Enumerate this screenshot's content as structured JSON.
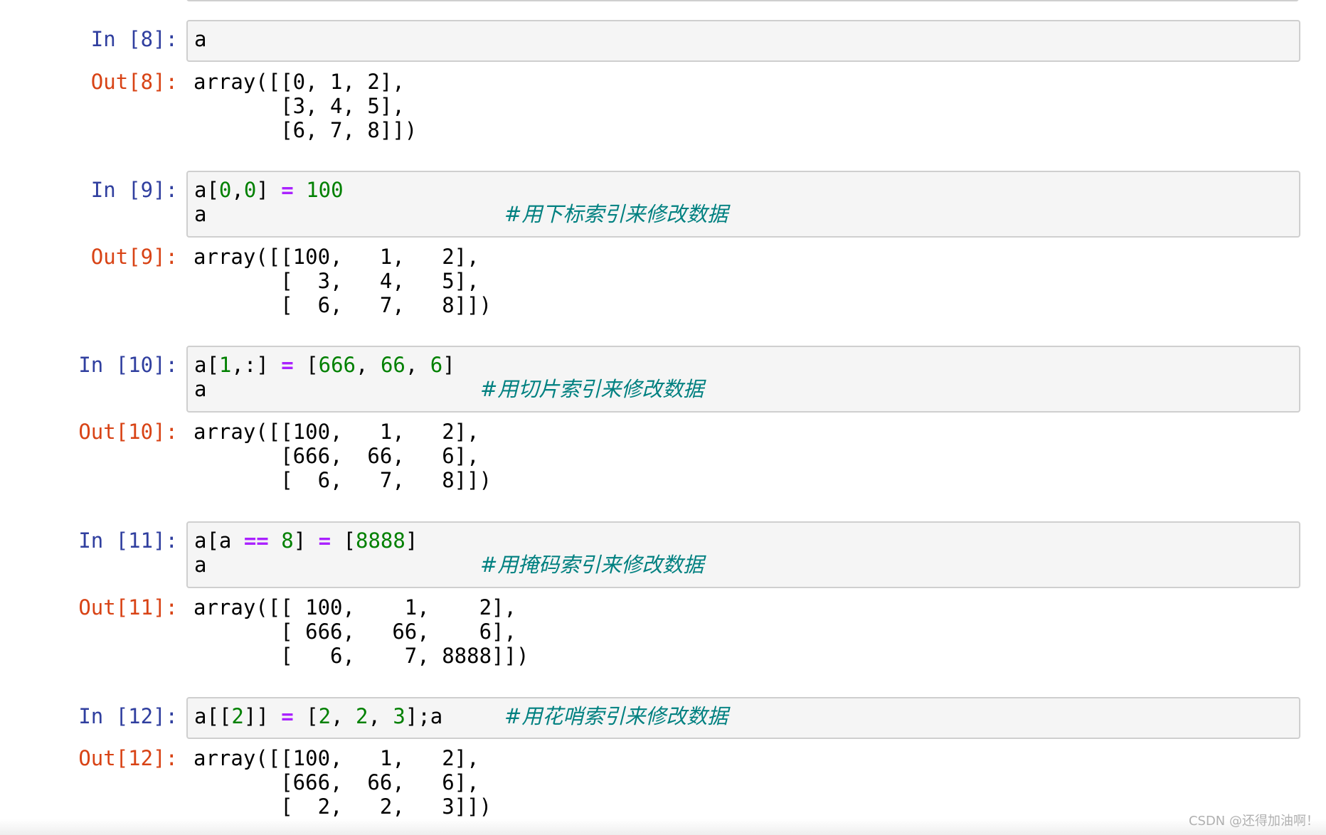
{
  "cells": [
    {
      "in_prompt": "In [8]:",
      "code": [
        "a"
      ],
      "comment": "",
      "out_prompt": "Out[8]:",
      "output": [
        "array([[0, 1, 2],",
        "       [3, 4, 5],",
        "       [6, 7, 8]])"
      ]
    },
    {
      "in_prompt": "In [9]:",
      "code": [
        "a[0,0] = 100",
        "a"
      ],
      "comment": "#用下标索引来修改数据",
      "out_prompt": "Out[9]:",
      "output": [
        "array([[100,   1,   2],",
        "       [  3,   4,   5],",
        "       [  6,   7,   8]])"
      ]
    },
    {
      "in_prompt": "In [10]:",
      "code": [
        "a[1,:] = [666, 66, 6]",
        "a"
      ],
      "comment": "#用切片索引来修改数据",
      "out_prompt": "Out[10]:",
      "output": [
        "array([[100,   1,   2],",
        "       [666,  66,   6],",
        "       [  6,   7,   8]])"
      ]
    },
    {
      "in_prompt": "In [11]:",
      "code": [
        "a[a == 8] = [8888]",
        "a"
      ],
      "comment": "#用掩码索引来修改数据",
      "out_prompt": "Out[11]:",
      "output": [
        "array([[ 100,    1,    2],",
        "       [ 666,   66,    6],",
        "       [   6,    7, 8888]])"
      ]
    },
    {
      "in_prompt": "In [12]:",
      "code": [
        "a[[2]] = [2, 2, 3];a"
      ],
      "comment": "#用花哨索引来修改数据",
      "out_prompt": "Out[12]:",
      "output": [
        "array([[100,   1,   2],",
        "       [666,  66,   6],",
        "       [  2,   2,   3]])"
      ]
    }
  ],
  "watermark": "CSDN @还得加油啊！",
  "colors": {
    "in_prompt": "#303f9f",
    "out_prompt": "#d84315",
    "number": "#008000",
    "operator": "#aa22ff",
    "comment": "#008080",
    "input_bg": "#f5f5f5",
    "input_border": "#cfcfcf"
  }
}
